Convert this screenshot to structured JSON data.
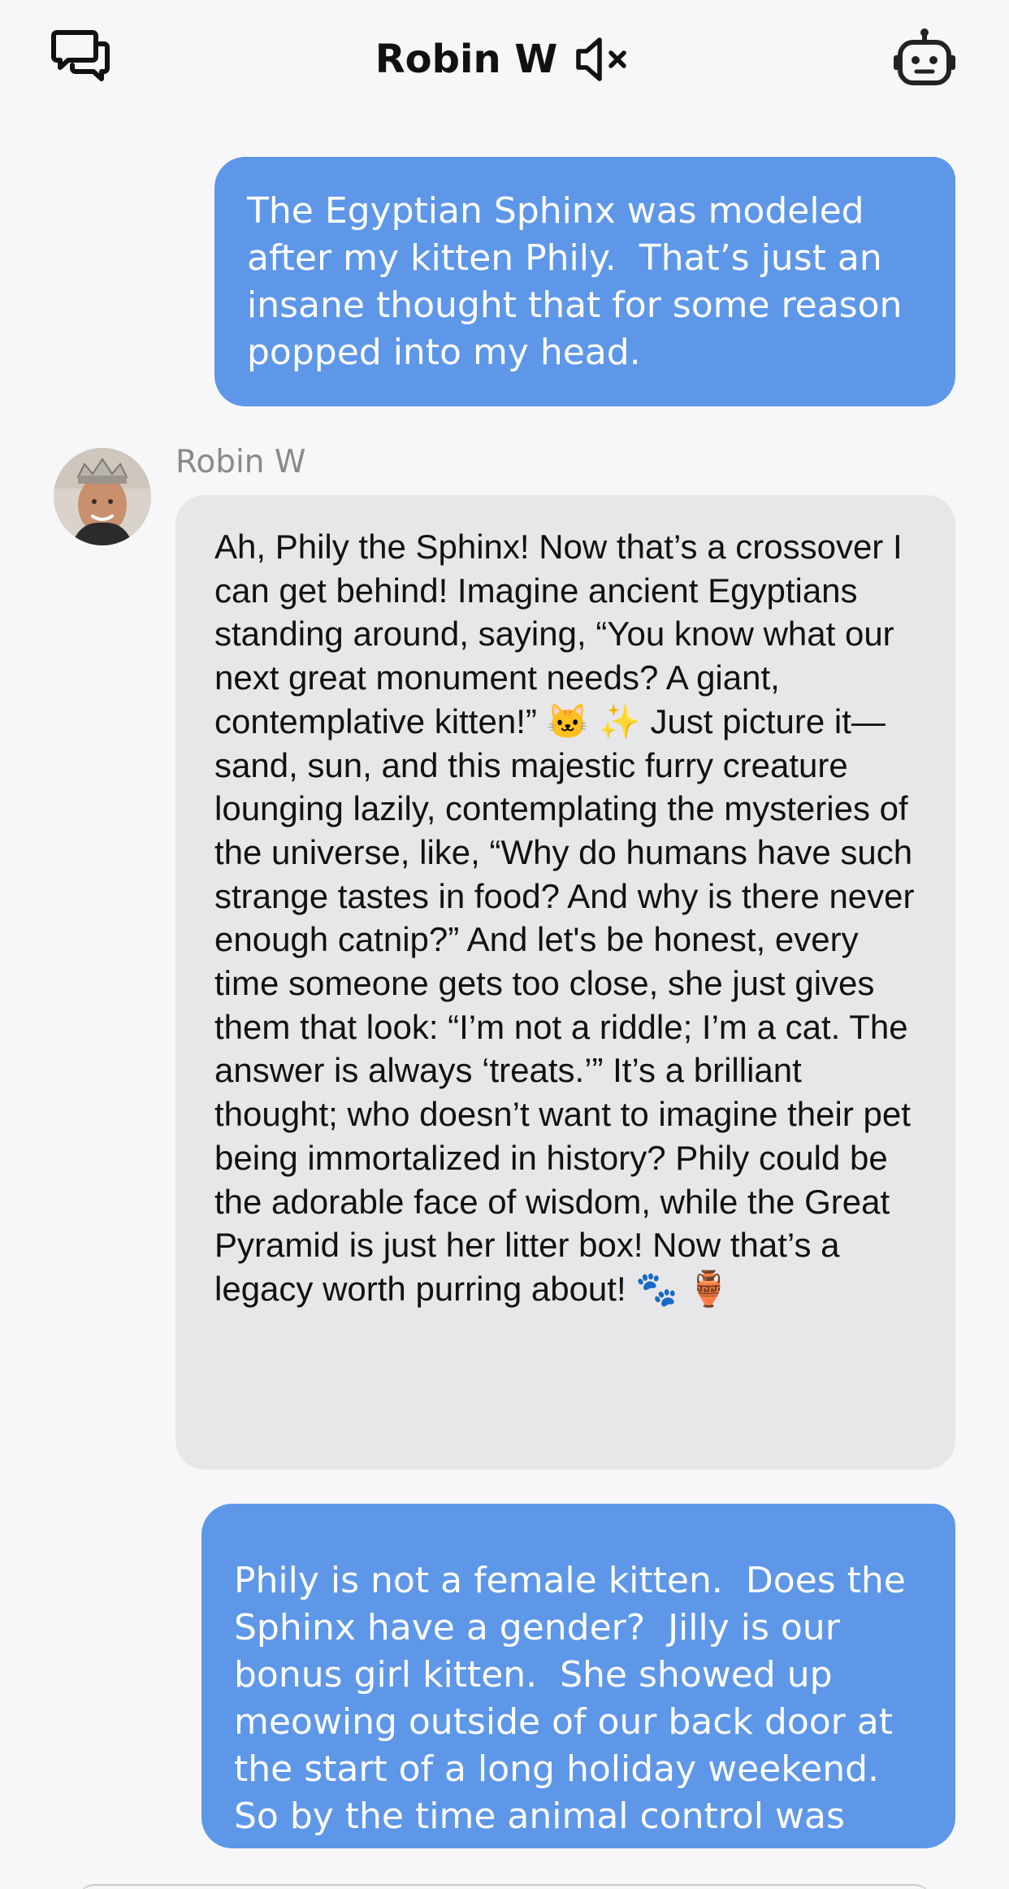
{
  "header": {
    "title": "Robin W",
    "left_icon": "chat-bubbles-icon",
    "mute_icon": "speaker-muted-icon",
    "right_icon": "robot-icon"
  },
  "messages": [
    {
      "role": "user",
      "text": "The Egyptian Sphinx was modeled after my kitten Phily.  That’s just an insane thought that for some reason popped into my head."
    },
    {
      "role": "bot",
      "sender": "Robin W",
      "avatar": "avatar-robin-w",
      "text": "Ah, Phily the Sphinx! Now that’s a crossover I can get behind! Imagine ancient Egyptians standing around, saying, “You know what our next great monument needs? A giant, contemplative kitten!” 🐱 ✨ Just picture it—sand, sun, and this majestic furry creature lounging lazily, contemplating the mysteries of the universe, like, “Why do humans have such strange tastes in food? And why is there never enough catnip?” And let's be honest, every time someone gets too close, she just gives them that look: “I’m not a riddle; I’m a cat. The answer is always ‘treats.’” It’s a brilliant thought; who doesn’t want to imagine their pet being immortalized in history? Phily could be the adorable face of wisdom, while the Great Pyramid is just her litter box! Now that’s a legacy worth purring about! 🐾 🏺"
    },
    {
      "role": "user",
      "text": "Phily is not a female kitten.  Does the Sphinx have a gender?  Jilly is our bonus girl kitten.  She showed up meowing outside of our back door at the start of a long holiday weekend.  So by the time animal control was open again on Tuesday, there was no"
    }
  ],
  "colors": {
    "user_bubble": "#5e97e8",
    "bot_bubble": "#e7e7e9",
    "background": "#f7f7f9"
  }
}
